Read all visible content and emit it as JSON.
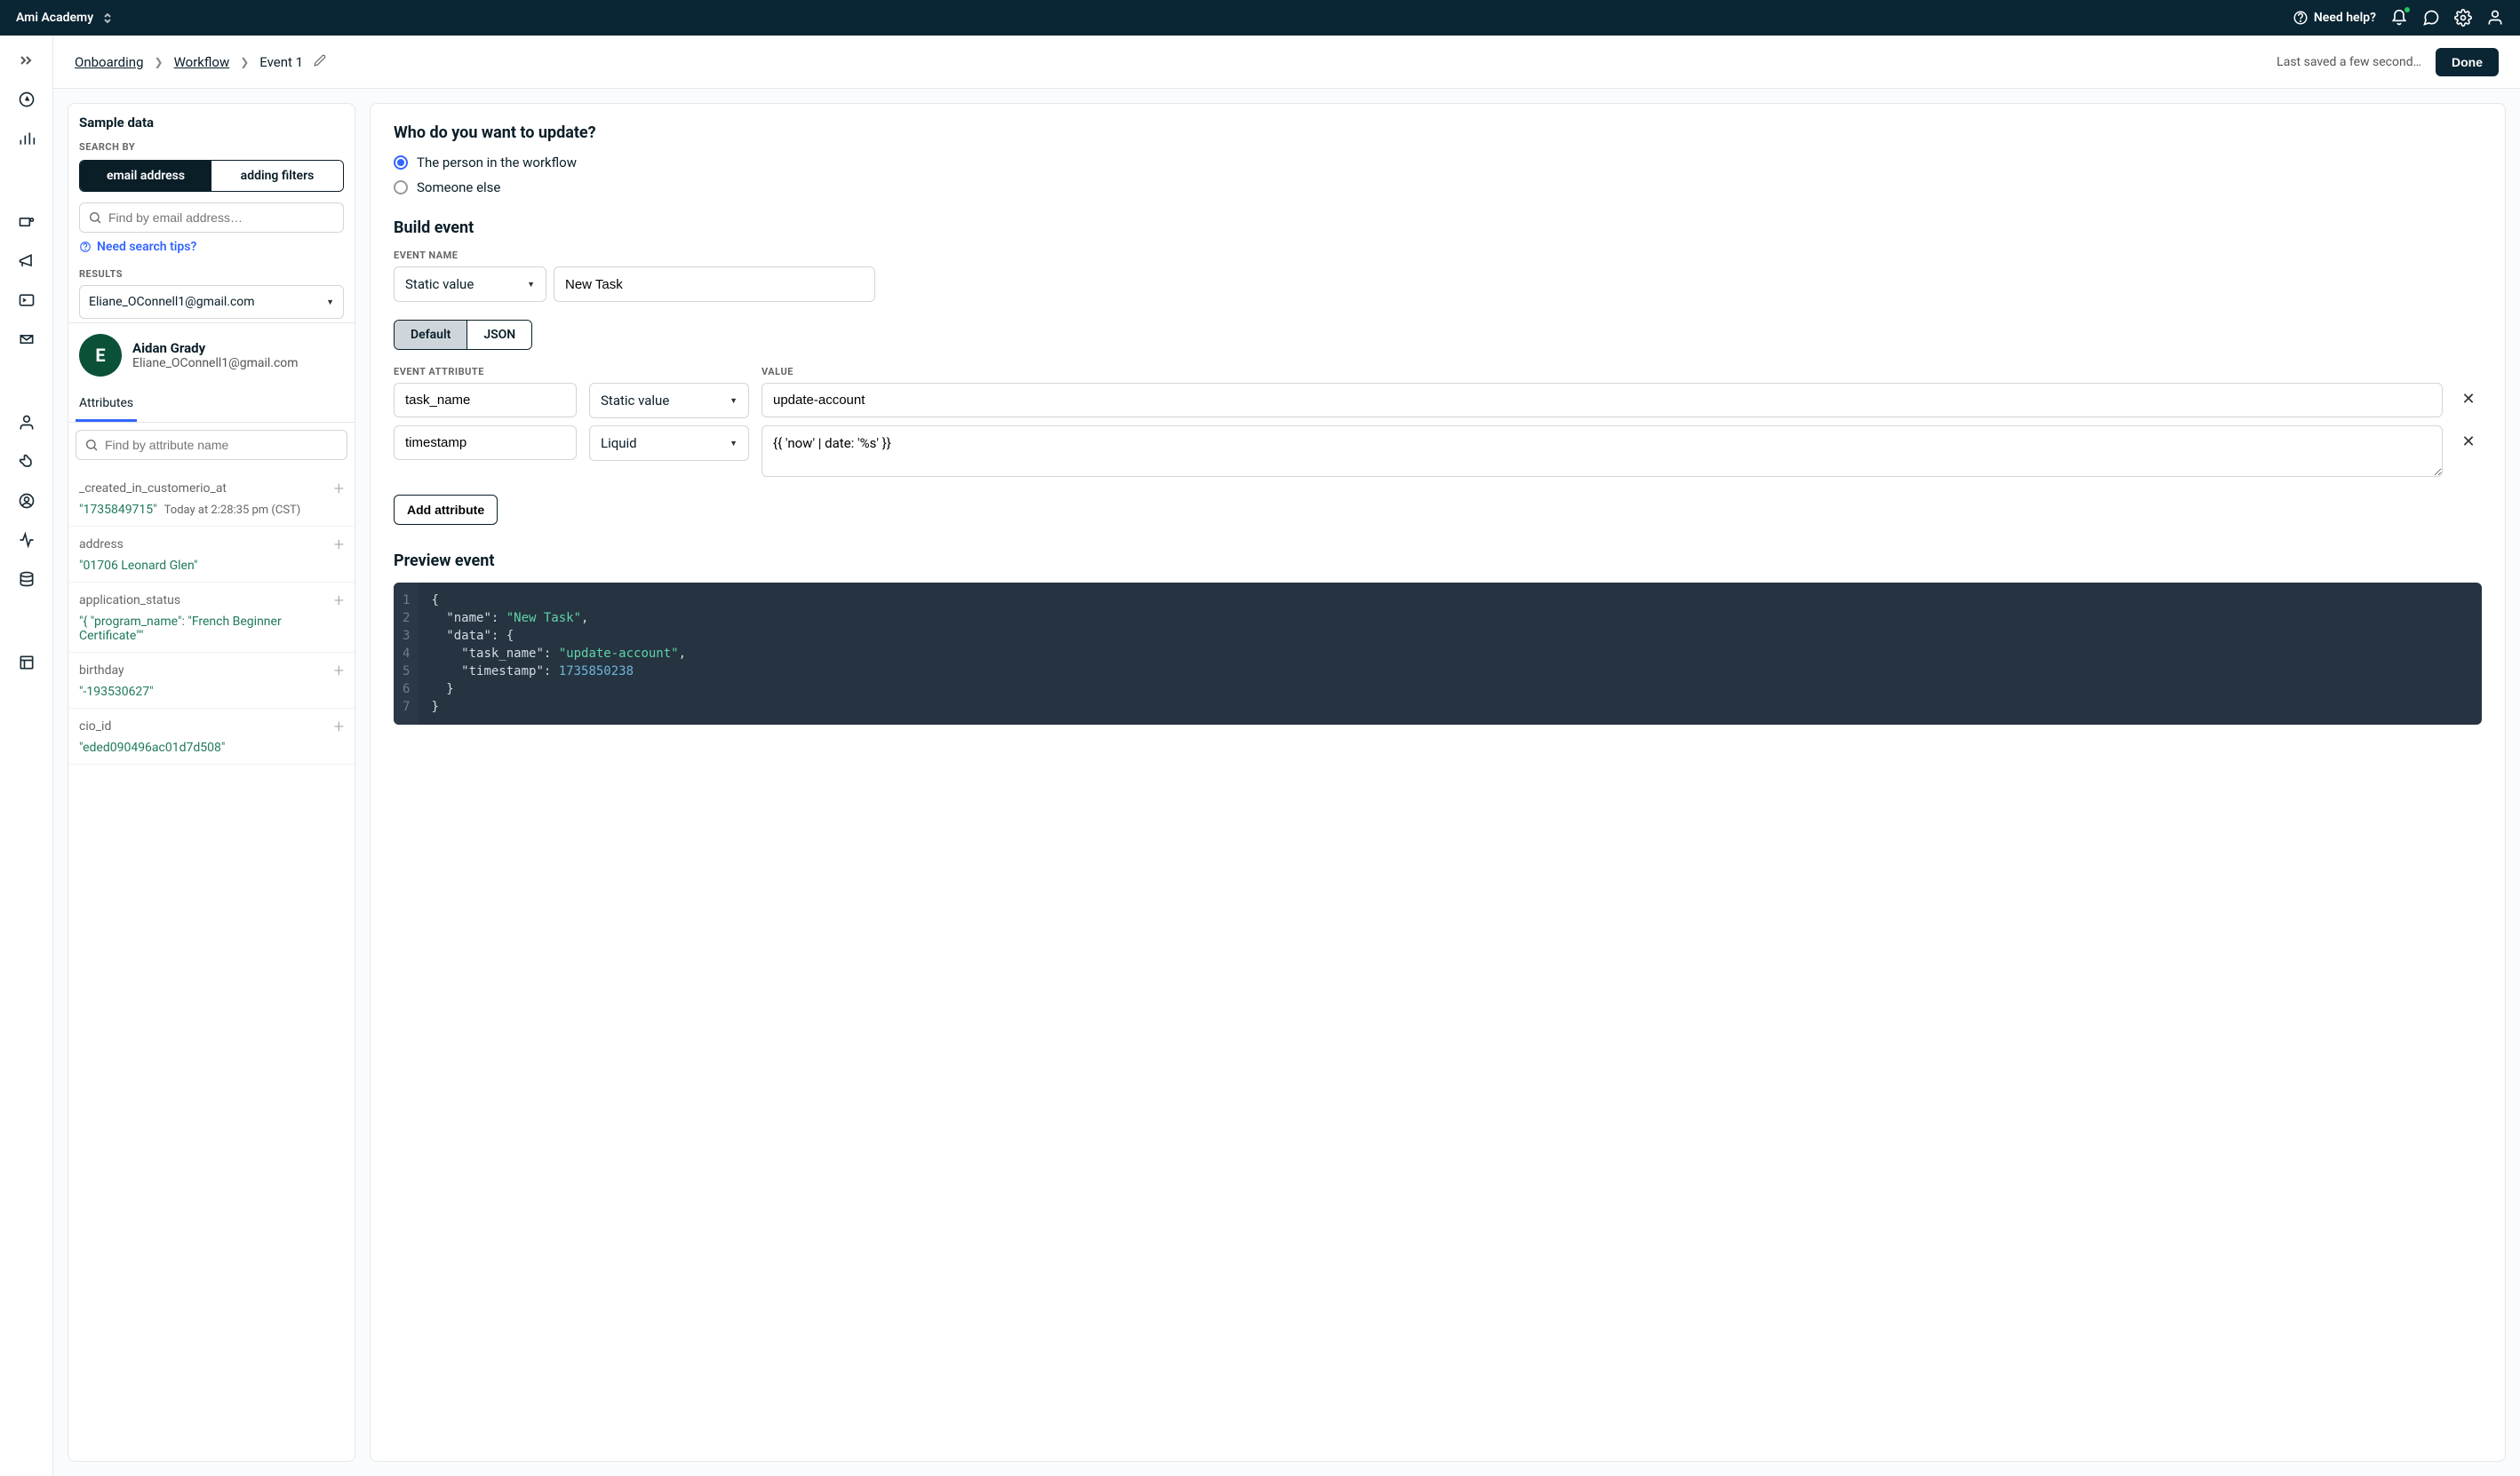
{
  "header": {
    "workspace_name": "Ami Academy",
    "need_help_label": "Need help?"
  },
  "breadcrumb": {
    "items": [
      "Onboarding",
      "Workflow"
    ],
    "current": "Event 1",
    "save_status": "Last saved a few second…",
    "done_label": "Done"
  },
  "left_panel": {
    "title": "Sample data",
    "search_by_label": "SEARCH BY",
    "search_tabs": [
      "email address",
      "adding filters"
    ],
    "search_placeholder": "Find by email address…",
    "search_tips": "Need search tips?",
    "results_label": "RESULTS",
    "selected_result": "Eliane_OConnell1@gmail.com",
    "person": {
      "initial": "E",
      "name": "Aidan Grady",
      "email": "Eliane_OConnell1@gmail.com"
    },
    "tabs": [
      "Attributes"
    ],
    "attr_search_placeholder": "Find by attribute name",
    "attributes": [
      {
        "name": "_created_in_customerio_at",
        "value": "\"1735849715\"",
        "meta": "Today at 2:28:35 pm (CST)"
      },
      {
        "name": "address",
        "value": "\"01706 Leonard Glen\""
      },
      {
        "name": "application_status",
        "value": "\"{ \"program_name\": \"French Beginner Certificate\"\""
      },
      {
        "name": "birthday",
        "value": "\"-193530627\""
      },
      {
        "name": "cio_id",
        "value": "\"eded090496ac01d7d508\""
      }
    ]
  },
  "main": {
    "who_title": "Who do you want to update?",
    "radio_options": [
      "The person in the workflow",
      "Someone else"
    ],
    "build_event_title": "Build event",
    "event_name_label": "EVENT NAME",
    "event_name_type": "Static value",
    "event_name_value": "New Task",
    "view_tabs": [
      "Default",
      "JSON"
    ],
    "attr_col_label": "EVENT ATTRIBUTE",
    "value_col_label": "VALUE",
    "attribute_rows": [
      {
        "name": "task_name",
        "type": "Static value",
        "value": "update-account"
      },
      {
        "name": "timestamp",
        "type": "Liquid",
        "value": "{{ 'now' | date: '%s' }}",
        "multiline": true
      }
    ],
    "add_attribute_label": "Add attribute",
    "preview_title": "Preview event",
    "preview_code": {
      "name_key": "\"name\"",
      "name_val": "\"New Task\"",
      "data_key": "\"data\"",
      "task_key": "\"task_name\"",
      "task_val": "\"update-account\"",
      "ts_key": "\"timestamp\"",
      "ts_val": "1735850238"
    }
  }
}
